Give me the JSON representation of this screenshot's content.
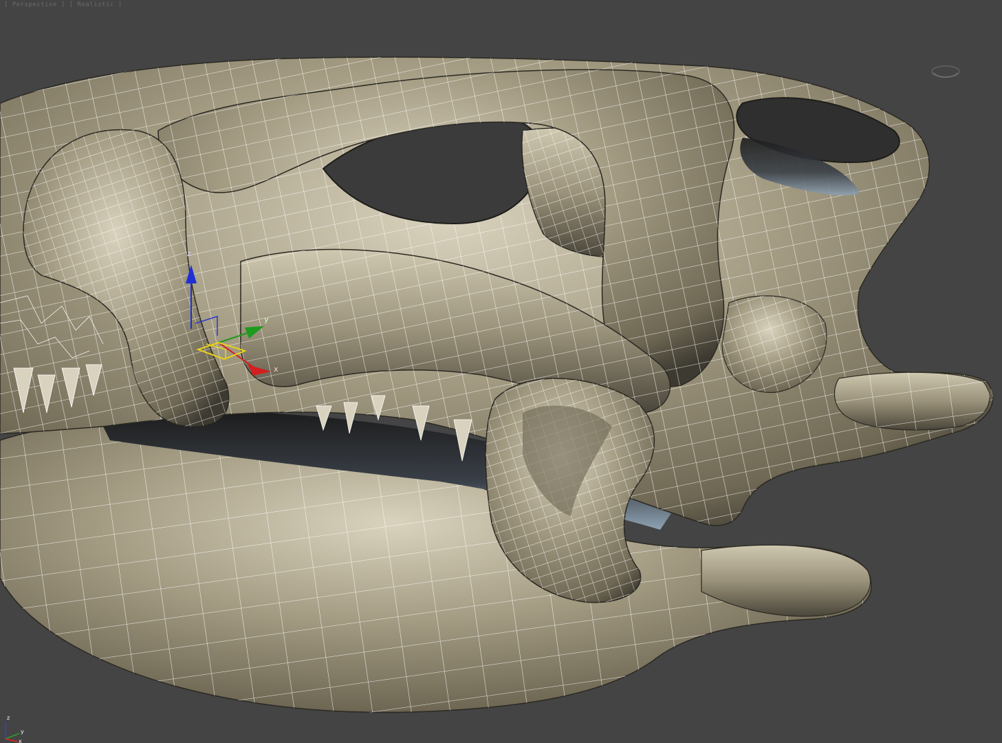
{
  "viewport": {
    "label": "[ Perspective ] [ Realistic ]",
    "background": "#444444",
    "model_color": "#a39b82",
    "wire_color": "#ffffff"
  },
  "gizmo": {
    "axis_x": "x",
    "axis_y": "y",
    "axis_z": "z",
    "color_x": "#d21f1f",
    "color_y": "#1e9a1e",
    "color_z": "#1f2fd6",
    "color_plane": "#e8d21a"
  },
  "world_axis": {
    "axis_x": "x",
    "axis_y": "y",
    "axis_z": "z"
  }
}
